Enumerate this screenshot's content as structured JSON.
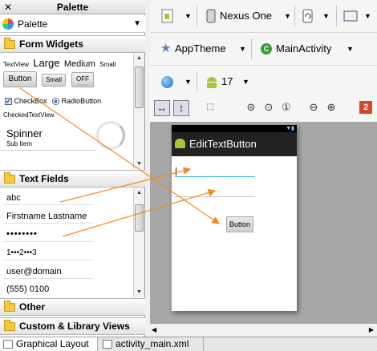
{
  "palette": {
    "header_title": "Palette",
    "close_glyph": "✕",
    "selector_label": "Palette",
    "categories": {
      "form_widgets": "Form Widgets",
      "text_fields": "Text Fields",
      "other": "Other",
      "custom": "Custom & Library Views"
    },
    "form_widgets": {
      "textview": "TextView",
      "large": "Large",
      "medium": "Medium",
      "small": "Small",
      "button": "Button",
      "small_button": "Small",
      "toggle": "OFF",
      "checkbox": "CheckBox",
      "radio": "RadioButton",
      "checked_textview": "CheckedTextView",
      "spinner": "Spinner",
      "spinner_sub": "Sub Item"
    },
    "text_fields": [
      "abc",
      "Firstname Lastname",
      "••••••••",
      "1•••2•••3",
      "user@domain",
      "(555) 0100"
    ]
  },
  "toolbar": {
    "device": "Nexus One",
    "theme": "AppTheme",
    "activity": "MainActivity",
    "api_level": "17"
  },
  "zoom": {
    "error_count": "2"
  },
  "device_preview": {
    "app_title": "EditTextButton",
    "button_label": "Button"
  },
  "bottom_tabs": {
    "graphical": "Graphical Layout",
    "xml": "activity_main.xml"
  },
  "colors": {
    "arrow": "#f08a1c",
    "focus_underline": "#33b5e5",
    "error_badge": "#d9472b"
  }
}
